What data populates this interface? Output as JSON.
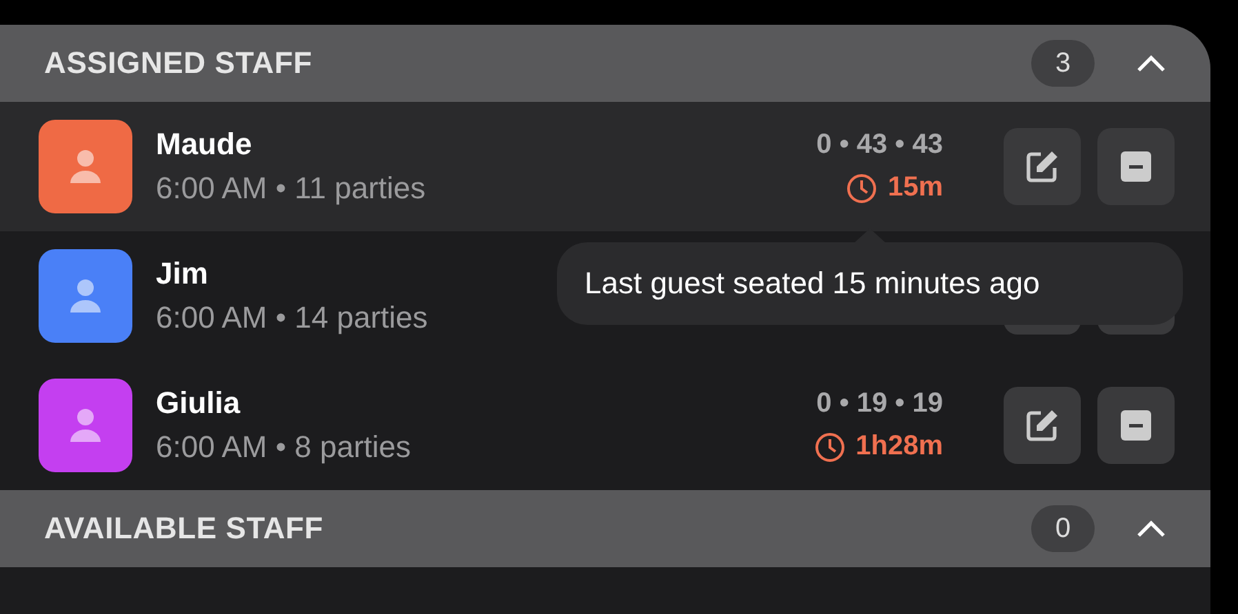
{
  "sections": [
    {
      "title": "ASSIGNED STAFF",
      "count": "3",
      "expanded": true,
      "staff": [
        {
          "name": "Maude",
          "color": "#ef6a45",
          "hovered": true,
          "detail": "6:00 AM • 11 parties",
          "stats": "0 • 43 • 43",
          "last_seated": "15m"
        },
        {
          "name": "Jim",
          "color": "#4a80f7",
          "hovered": false,
          "detail": "6:00 AM • 14 parties"
        },
        {
          "name": "Giulia",
          "color": "#c43ff0",
          "hovered": false,
          "detail": "6:00 AM • 8 parties",
          "stats": "0 • 19 • 19",
          "last_seated": "1h28m"
        }
      ]
    },
    {
      "title": "AVAILABLE STAFF",
      "count": "0",
      "expanded": true
    }
  ],
  "tooltip": {
    "text": "Last guest seated 15 minutes ago"
  }
}
